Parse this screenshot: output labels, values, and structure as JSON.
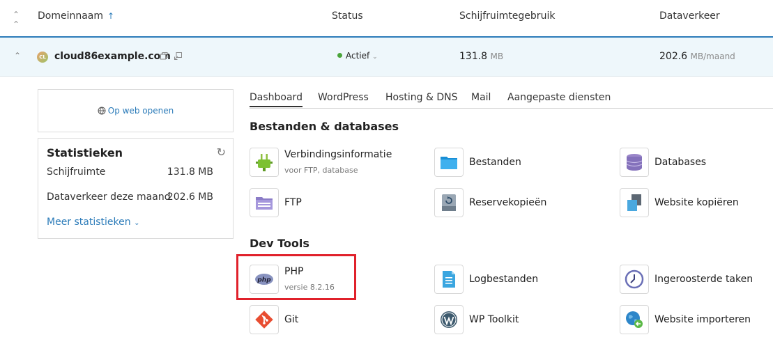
{
  "header": {
    "columns": {
      "domain": "Domeinnaam",
      "status": "Status",
      "disk": "Schijfruimtegebruik",
      "traffic": "Dataverkeer"
    },
    "sort_arrow": "↑"
  },
  "domain_row": {
    "name": "cloud86example.com",
    "favicon_text": "CL",
    "status": "Actief",
    "disk_value": "131.8",
    "disk_unit": "MB",
    "traffic_value": "202.6",
    "traffic_unit": "MB/maand"
  },
  "left_panel": {
    "open_web": "Op web openen",
    "stats": {
      "title": "Statistieken",
      "rows": [
        {
          "label": "Schijfruimte",
          "value": "131.8 MB"
        },
        {
          "label": "Dataverkeer deze maand",
          "value": "202.6 MB"
        }
      ],
      "more": "Meer statistieken"
    }
  },
  "tabs": [
    "Dashboard",
    "WordPress",
    "Hosting & DNS",
    "Mail",
    "Aangepaste diensten"
  ],
  "sections": {
    "files_db": {
      "title": "Bestanden & databases",
      "tools": [
        {
          "name": "Verbindingsinformatie",
          "sub": "voor FTP, database",
          "icon": "plug-icon"
        },
        {
          "name": "Bestanden",
          "icon": "folder-icon"
        },
        {
          "name": "Databases",
          "icon": "database-icon"
        },
        {
          "name": "FTP",
          "icon": "ftp-folder-icon"
        },
        {
          "name": "Reservekopieën",
          "icon": "backup-icon"
        },
        {
          "name": "Website kopiëren",
          "icon": "copy-site-icon"
        }
      ]
    },
    "dev_tools": {
      "title": "Dev Tools",
      "tools": [
        {
          "name": "PHP",
          "sub": "versie 8.2.16",
          "icon": "php-icon",
          "icon_text": "php"
        },
        {
          "name": "Logbestanden",
          "icon": "log-file-icon"
        },
        {
          "name": "Ingeroosterde taken",
          "icon": "clock-icon"
        },
        {
          "name": "Git",
          "icon": "git-icon"
        },
        {
          "name": "WP Toolkit",
          "icon": "wordpress-icon"
        },
        {
          "name": "Website importeren",
          "icon": "import-globe-icon"
        }
      ]
    }
  },
  "colors": {
    "accent": "#2b7bb9",
    "highlight": "#e0212b",
    "active_green": "#4aa53b"
  }
}
